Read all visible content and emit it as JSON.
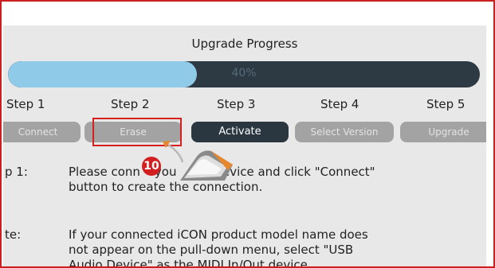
{
  "window": {
    "title": "Upgrade Progress"
  },
  "progress": {
    "value": 0.4,
    "label": "40%"
  },
  "steps": [
    {
      "step_label": "Step 1",
      "button_label": "Connect",
      "active": false
    },
    {
      "step_label": "Step 2",
      "button_label": "Erase",
      "active": false
    },
    {
      "step_label": "Step 3",
      "button_label": "Activate",
      "active": true
    },
    {
      "step_label": "Step 4",
      "button_label": "Select Version",
      "active": false
    },
    {
      "step_label": "Step 5",
      "button_label": "Upgrade",
      "active": false
    }
  ],
  "instructions": {
    "step_ref": "p 1:",
    "step_line1": "Please conn",
    "step_line1b": "you",
    "step_line1c": "N device and click \"Connect\"",
    "step_line2": "button to create the connection.",
    "note_ref": "te:",
    "note_line1": "If your connected iCON product model name does",
    "note_line2": "not appear on the pull-down menu, select \"USB",
    "note_line3": "Audio Device\" as the MIDI In/Out device."
  },
  "callout": {
    "number": "10"
  },
  "colors": {
    "border": "#cc1f1f",
    "progress_fill": "#8fcae8",
    "progress_track": "#2d3943",
    "button_active": "#2a3640",
    "button_inactive": "#a3a3a3",
    "highlight": "#d62020",
    "callout_badge": "#d31f1f"
  }
}
